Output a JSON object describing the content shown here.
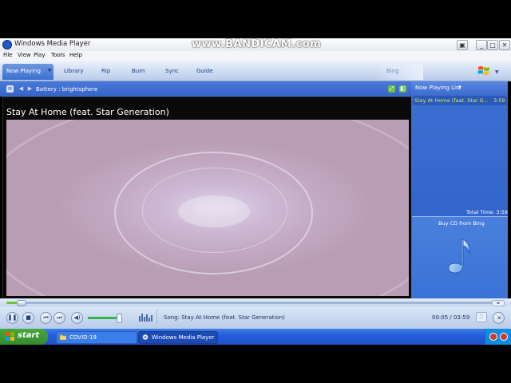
{
  "window": {
    "title": "Windows Media Player",
    "watermark": "www.BANDICAM.com"
  },
  "menu": [
    "File",
    "View",
    "Play",
    "Tools",
    "Help"
  ],
  "tabs": {
    "now_playing": "Now Playing",
    "library": "Library",
    "rip": "Rip",
    "burn": "Burn",
    "sync": "Sync",
    "guide": "Guide",
    "bing": "Bing"
  },
  "infobar": {
    "visualization": "Battery : brightsphere"
  },
  "video": {
    "song_title": "Stay At Home (feat. Star Generation)"
  },
  "playlist": {
    "header": "Now Playing List",
    "items": [
      {
        "title": "Stay At Home (feat. Star G...",
        "duration": "3:59"
      }
    ],
    "total_time": "Total Time: 3:59",
    "buy_cd": "Buy CD from Bing"
  },
  "player": {
    "seek_fraction": 0.021,
    "volume_fraction": 0.85,
    "status": "Song: Stay At Home (feat. Star Generation)",
    "time": "00:05 / 03:59"
  },
  "taskbar": {
    "start": "start",
    "tasks": [
      "COVID-19",
      "Windows Media Player"
    ]
  },
  "colors": {
    "accent": "#3366cc",
    "playlist_text": "#c7f05c",
    "taskbar": "#245edb",
    "start": "#318b2c"
  }
}
